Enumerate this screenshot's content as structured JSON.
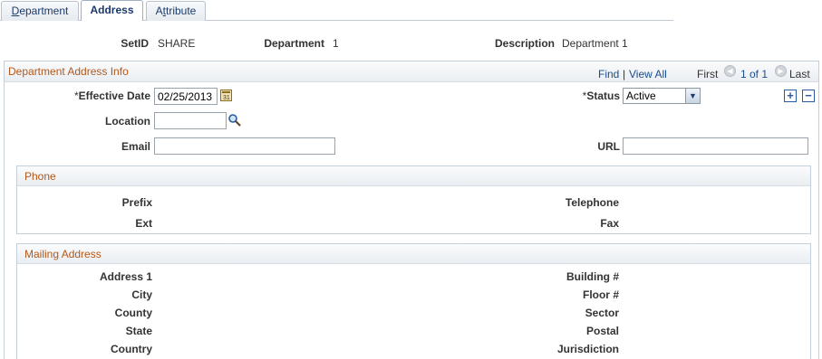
{
  "tabs": {
    "department": {
      "pre": "",
      "ul": "D",
      "post": "epartment"
    },
    "address": {
      "label": "Address"
    },
    "attribute": {
      "pre": "A",
      "ul": "t",
      "post": "tribute"
    }
  },
  "keys": {
    "setid_label": "SetID",
    "setid_value": "SHARE",
    "dept_label": "Department",
    "dept_value": "1",
    "desc_label": "Description",
    "desc_value": "Department 1"
  },
  "scroll": {
    "title": "Department Address Info",
    "find": "Find",
    "sep": "|",
    "view_all": "View All",
    "first": "First",
    "count": "1 of 1",
    "last": "Last"
  },
  "form": {
    "effdt_req": "*",
    "effdt_label": "Effective Date",
    "effdt_value": "02/25/2013",
    "status_req": "*",
    "status_label": "Status",
    "status_value": "Active",
    "location_label": "Location",
    "location_value": "",
    "email_label": "Email",
    "email_value": "",
    "url_label": "URL",
    "url_value": "",
    "add_row": "+",
    "delete_row": "−"
  },
  "phone": {
    "title": "Phone",
    "prefix": "Prefix",
    "telephone": "Telephone",
    "ext": "Ext",
    "fax": "Fax"
  },
  "mailing": {
    "title": "Mailing Address",
    "address1": "Address 1",
    "city": "City",
    "county": "County",
    "state": "State",
    "country": "Country",
    "building": "Building #",
    "floor": "Floor #",
    "sector": "Sector",
    "postal": "Postal",
    "jurisdiction": "Jurisdiction"
  },
  "colors": {
    "section_title": "#b3581a",
    "link": "#1a4d8f",
    "button_blue": "#2c5aa0"
  },
  "icons": {
    "calendar": "calendar-icon",
    "lookup": "magnifier-icon",
    "prev": "prev-arrow-icon",
    "next": "next-arrow-icon"
  }
}
